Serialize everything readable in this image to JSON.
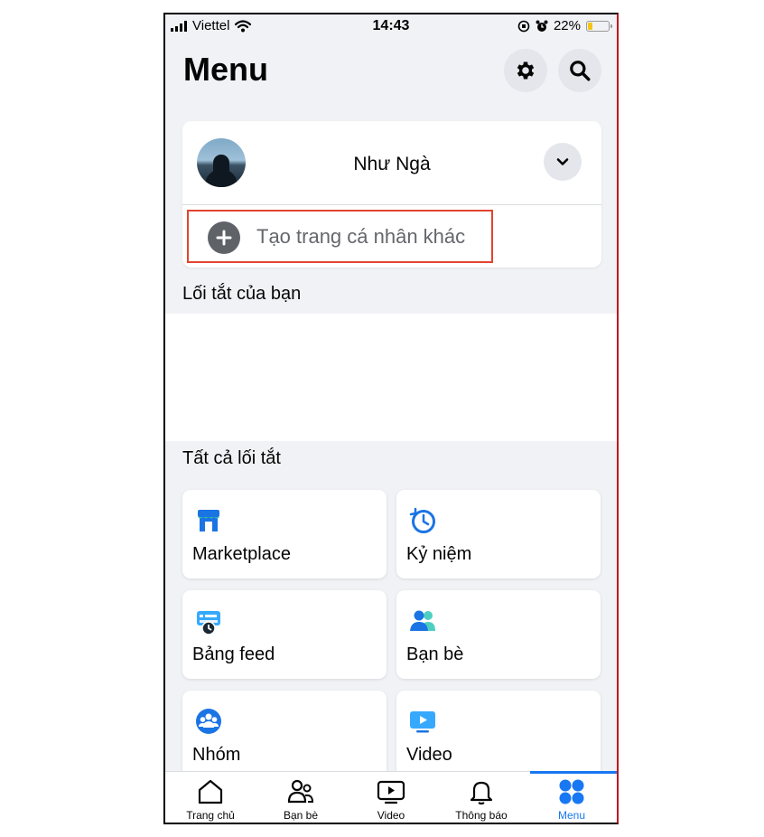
{
  "status_bar": {
    "carrier": "Viettel",
    "time": "14:43",
    "battery": "22%",
    "battery_level": 0.22
  },
  "header": {
    "title": "Menu",
    "settings_icon": "gear-icon",
    "search_icon": "search-icon"
  },
  "profile": {
    "name": "Như Ngà",
    "create_profile_label": "Tạo trang cá nhân khác"
  },
  "sections": {
    "your_shortcuts": "Lối tắt của bạn",
    "all_shortcuts": "Tất cả lối tắt"
  },
  "shortcuts": [
    {
      "label": "Marketplace",
      "icon": "marketplace-icon"
    },
    {
      "label": "Kỷ niệm",
      "icon": "memories-icon"
    },
    {
      "label": "Bảng feed",
      "icon": "feeds-icon"
    },
    {
      "label": "Bạn bè",
      "icon": "friends-icon"
    },
    {
      "label": "Nhóm",
      "icon": "groups-icon"
    },
    {
      "label": "Video",
      "icon": "video-icon"
    }
  ],
  "tab_bar": [
    {
      "label": "Trang chủ",
      "icon": "home-icon"
    },
    {
      "label": "Bạn bè",
      "icon": "friends-icon"
    },
    {
      "label": "Video",
      "icon": "video-icon"
    },
    {
      "label": "Thông báo",
      "icon": "bell-icon"
    },
    {
      "label": "Menu",
      "icon": "menu-grid-icon",
      "active": true
    }
  ],
  "colors": {
    "accent": "#1877f2",
    "highlight_border": "#e2442e",
    "background": "#f0f2f5"
  }
}
